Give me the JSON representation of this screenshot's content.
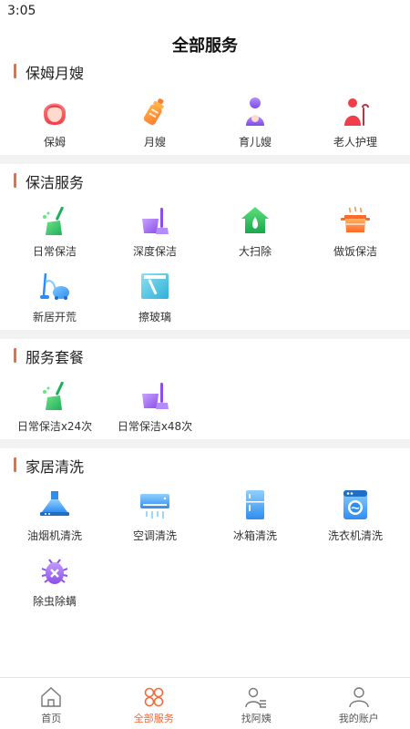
{
  "status_bar": {
    "time": "3:05"
  },
  "page_title": "全部服务",
  "sections": [
    {
      "title": "保姆月嫂",
      "items": [
        {
          "label": "保姆",
          "icon": "nanny-icon"
        },
        {
          "label": "月嫂",
          "icon": "baby-bottle-icon"
        },
        {
          "label": "育儿嫂",
          "icon": "childcare-icon"
        },
        {
          "label": "老人护理",
          "icon": "elderly-care-icon"
        }
      ]
    },
    {
      "title": "保洁服务",
      "items": [
        {
          "label": "日常保洁",
          "icon": "broom-icon"
        },
        {
          "label": "深度保洁",
          "icon": "bucket-mop-icon"
        },
        {
          "label": "大扫除",
          "icon": "house-cleaning-icon"
        },
        {
          "label": "做饭保洁",
          "icon": "cooking-pot-icon"
        },
        {
          "label": "新居开荒",
          "icon": "vacuum-icon"
        },
        {
          "label": "擦玻璃",
          "icon": "window-squeegee-icon"
        }
      ]
    },
    {
      "title": "服务套餐",
      "items": [
        {
          "label": "日常保洁x24次",
          "icon": "broom-icon"
        },
        {
          "label": "日常保洁x48次",
          "icon": "bucket-mop-icon"
        }
      ]
    },
    {
      "title": "家居清洗",
      "items": [
        {
          "label": "油烟机清洗",
          "icon": "range-hood-icon"
        },
        {
          "label": "空调清洗",
          "icon": "air-conditioner-icon"
        },
        {
          "label": "冰箱清洗",
          "icon": "fridge-icon"
        },
        {
          "label": "洗衣机清洗",
          "icon": "washing-machine-icon"
        },
        {
          "label": "除虫除螨",
          "icon": "bug-icon"
        }
      ]
    }
  ],
  "tabs": [
    {
      "label": "首页",
      "icon": "home-icon",
      "active": false
    },
    {
      "label": "全部服务",
      "icon": "all-services-icon",
      "active": true
    },
    {
      "label": "找阿姨",
      "icon": "find-helper-icon",
      "active": false
    },
    {
      "label": "我的账户",
      "icon": "account-icon",
      "active": false
    }
  ],
  "colors": {
    "accent": "#f46b3a",
    "separator": "#f2f2f2"
  }
}
